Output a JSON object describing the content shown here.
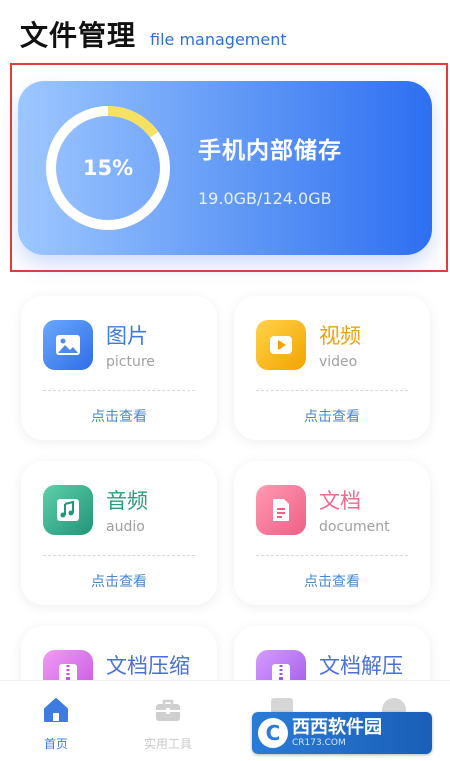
{
  "header": {
    "title": "文件管理",
    "subtitle": "file management"
  },
  "storage": {
    "title": "手机内部储存",
    "usage": "19.0GB/124.0GB",
    "percent_label": "15%",
    "percent": 0.15,
    "track_color": "#ffffff",
    "arc_color": "#f7e160"
  },
  "tiles": [
    {
      "name": "图片",
      "sub": "picture",
      "link": "点击查看",
      "icon": "image-icon",
      "name_color": "#3d7be0"
    },
    {
      "name": "视频",
      "sub": "video",
      "link": "点击查看",
      "icon": "play-icon",
      "name_color": "#f0a20b"
    },
    {
      "name": "音频",
      "sub": "audio",
      "link": "点击查看",
      "icon": "music-note-icon",
      "name_color": "#2f9b7f"
    },
    {
      "name": "文档",
      "sub": "document",
      "link": "点击查看",
      "icon": "document-icon",
      "name_color": "#ef6a8f"
    },
    {
      "name": "文档压缩",
      "icon": "zip-icon",
      "name_color": "#4a6fd8"
    },
    {
      "name": "文档解压",
      "icon": "unzip-icon",
      "name_color": "#4a6fd8"
    }
  ],
  "nav": [
    {
      "label": "首页",
      "icon": "home-icon",
      "active": true
    },
    {
      "label": "实用工具",
      "icon": "toolbox-icon",
      "active": false
    }
  ],
  "colors": {
    "accent": "#3d7be0",
    "nav_active": "#3d7be0",
    "nav_inactive": "#c9c9c9"
  },
  "watermark": {
    "brand": "西西软件园",
    "url": "CR173.COM"
  }
}
